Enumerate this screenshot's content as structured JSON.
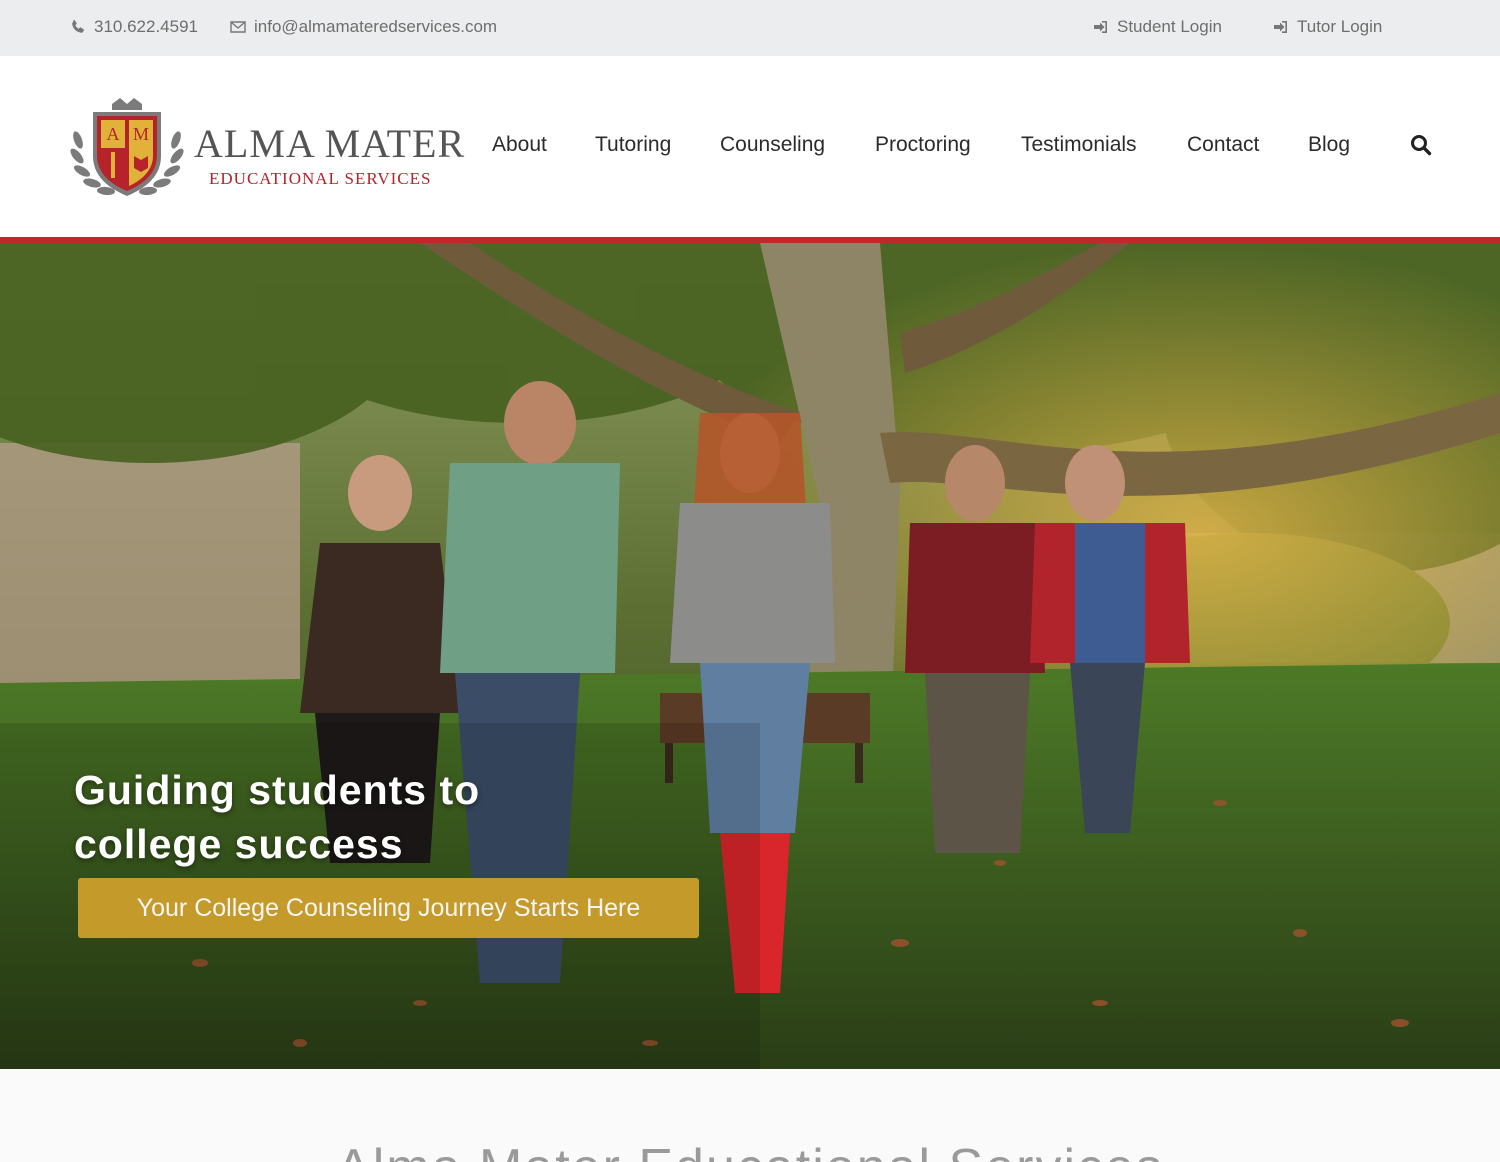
{
  "topbar": {
    "phone": "310.622.4591",
    "email": "info@almamateredservices.com",
    "student_login": "Student Login",
    "tutor_login": "Tutor Login"
  },
  "brand": {
    "name": "ALMA MATER",
    "tagline": "EDUCATIONAL SERVICES",
    "crest_letters": [
      "A",
      "M"
    ],
    "accent_color": "#c0282b",
    "gold_color": "#cc9f2b"
  },
  "nav": {
    "items": [
      {
        "label": "About"
      },
      {
        "label": "Tutoring"
      },
      {
        "label": "Counseling"
      },
      {
        "label": "Proctoring"
      },
      {
        "label": "Testimonials"
      },
      {
        "label": "Contact"
      },
      {
        "label": "Blog"
      }
    ],
    "search_icon": "search-icon"
  },
  "hero": {
    "headline": "Guiding students to college success",
    "cta_label": "Your College Counseling Journey Starts Here"
  },
  "section": {
    "title": "Alma Mater Educational Services"
  }
}
